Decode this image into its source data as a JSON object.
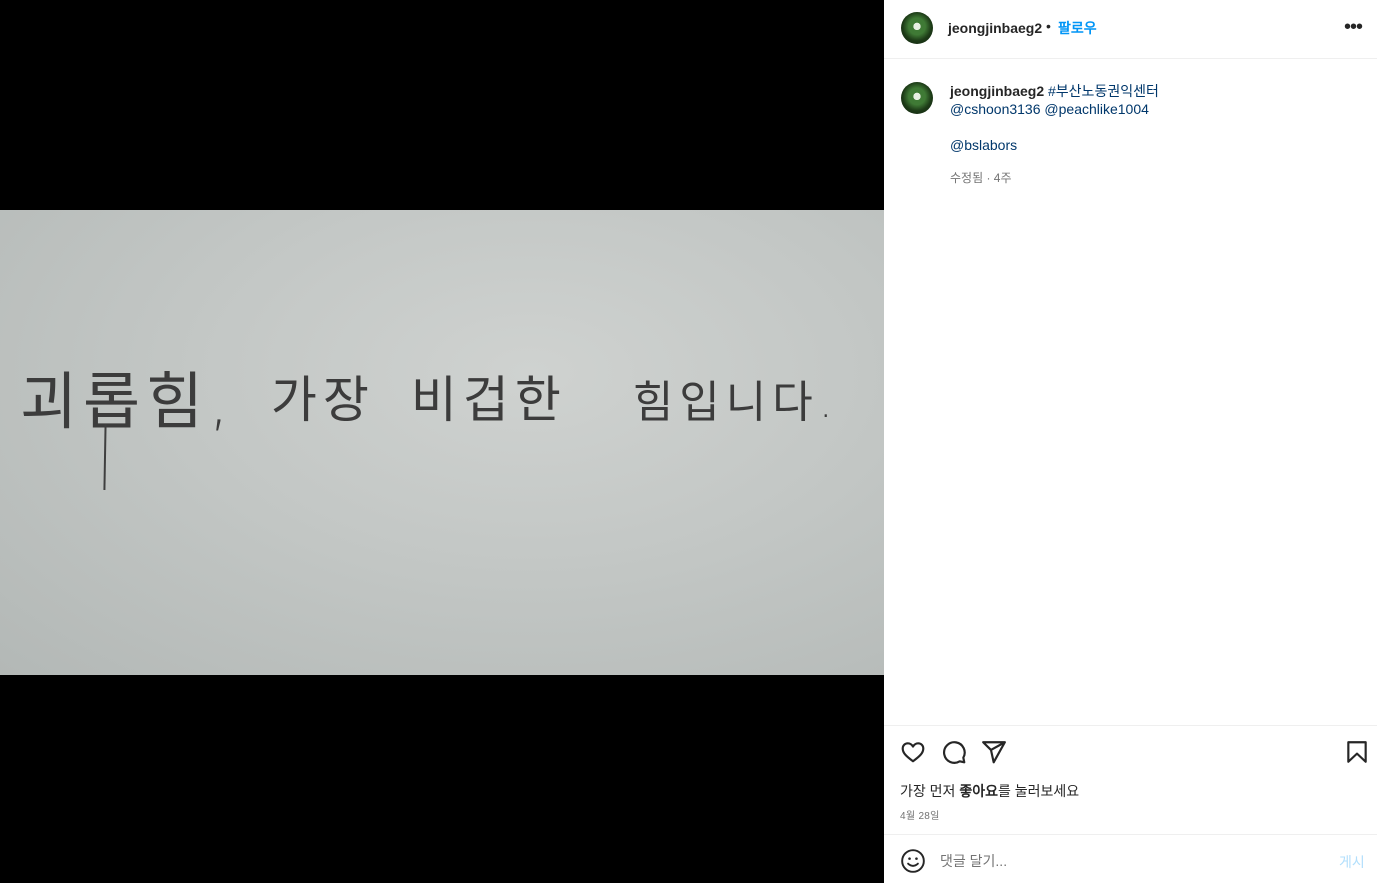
{
  "post": {
    "photo_text": [
      "괴롭힘,",
      "가장",
      "비겁한",
      "힘입니다."
    ]
  },
  "header": {
    "username": "jeongjinbaeg2",
    "separator": "•",
    "follow_label": "팔로우",
    "more_icon": "more-horizontal-icon"
  },
  "caption": {
    "username": "jeongjinbaeg2",
    "hashtag": "#부산노동권익센터",
    "mention_1": "@cshoon3136",
    "mention_2": "@peachlike1004",
    "mention_3": "@bslabors",
    "meta": "수정됨 · 4주"
  },
  "actions": {
    "like_icon": "heart-icon",
    "comment_icon": "comment-icon",
    "share_icon": "share-icon",
    "save_icon": "bookmark-icon",
    "likes_prefix": "가장 먼저 ",
    "likes_bold": "좋아요",
    "likes_suffix": "를 눌러보세요",
    "date": "4월 28일"
  },
  "comment": {
    "emoji_icon": "smiley-icon",
    "placeholder": "댓글 달기...",
    "post_label": "게시"
  },
  "colors": {
    "accent": "#0095f6",
    "link": "#00376b",
    "post_disabled": "#b2dffc"
  }
}
